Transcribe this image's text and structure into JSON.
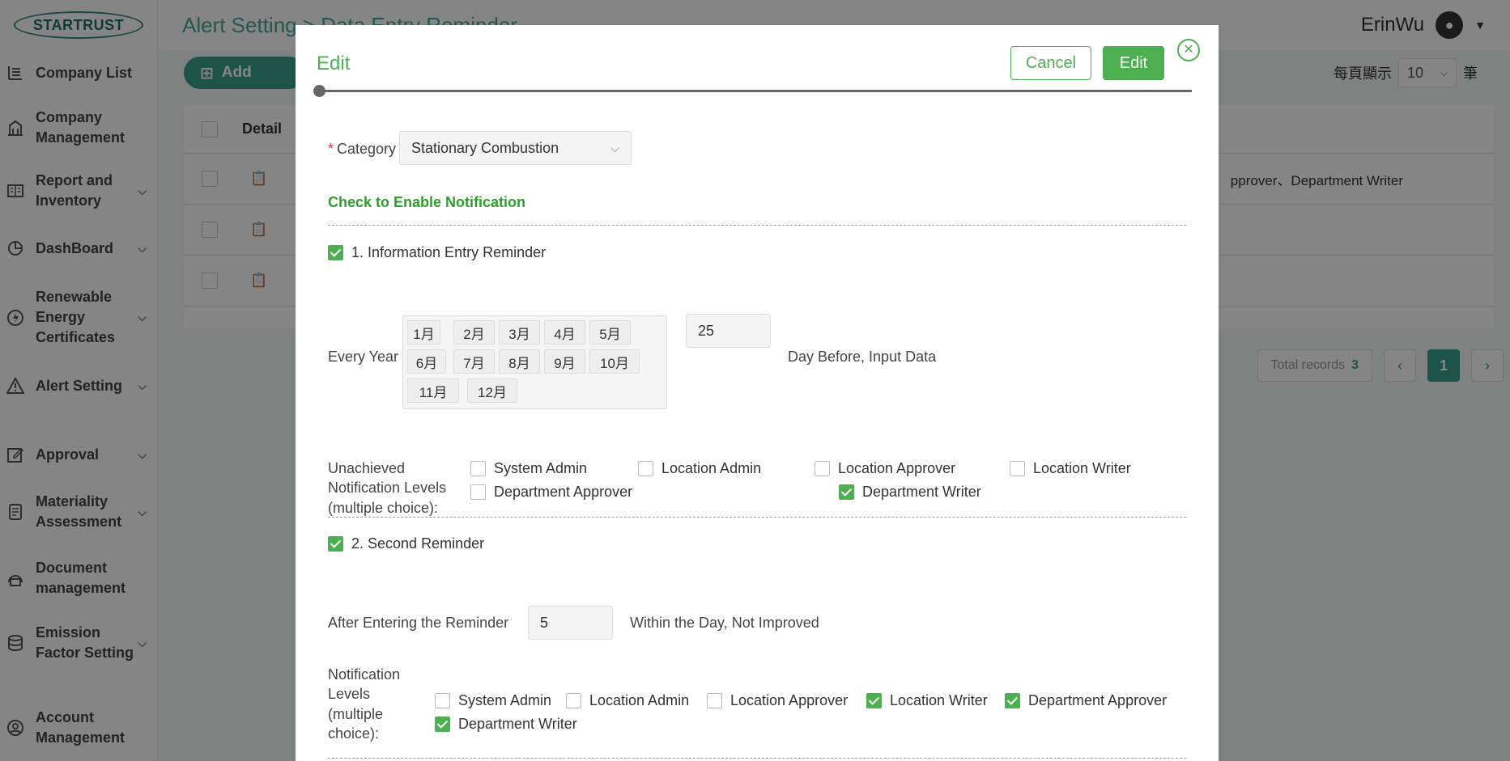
{
  "app": {
    "logo": "STARTRUST",
    "breadcrumb": "Alert Setting > Data Entry Reminder",
    "user": "ErinWu"
  },
  "sidebar": {
    "items": [
      {
        "label": "Company List",
        "icon": "list-icon"
      },
      {
        "label": "Company Management",
        "icon": "building-icon"
      },
      {
        "label": "Report and Inventory",
        "icon": "report-icon"
      },
      {
        "label": "DashBoard",
        "icon": "pie-chart-icon"
      },
      {
        "label": "Renewable Energy Certificates",
        "icon": "energy-icon"
      },
      {
        "label": "Alert Setting",
        "icon": "warning-icon"
      },
      {
        "label": "Approval",
        "icon": "edit-icon"
      },
      {
        "label": "Materiality Assessment",
        "icon": "book-icon"
      },
      {
        "label": "Document management",
        "icon": "document-icon"
      },
      {
        "label": "Emission Factor Setting",
        "icon": "database-icon"
      },
      {
        "label": "Account Management",
        "icon": "account-icon"
      }
    ]
  },
  "toolbar": {
    "add_label": "Add",
    "per_page_label": "每頁顯示",
    "per_page_value": "10",
    "per_page_unit": "筆"
  },
  "table": {
    "header_detail": "Detail",
    "row1_text": "pprover、Department Writer"
  },
  "pagination": {
    "total_label": "Total records",
    "total_value": "3",
    "current_page": "1"
  },
  "modal": {
    "title": "Edit",
    "cancel_label": "Cancel",
    "edit_label": "Edit",
    "category_label": "Category",
    "category_value": "Stationary Combustion",
    "section_title": "Check to Enable Notification",
    "reminder1_label": "1. Information Entry Reminder",
    "every_year_label": "Every Year",
    "months": [
      "1月",
      "2月",
      "3月",
      "4月",
      "5月",
      "6月",
      "7月",
      "8月",
      "9月",
      "10月",
      "11月",
      "12月"
    ],
    "day_value": "25",
    "day_suffix": "Day Before, Input Data",
    "unachieved_label_1": "Unachieved",
    "unachieved_label_2": "Notification Levels",
    "unachieved_label_3": "(multiple choice):",
    "levels1": {
      "system_admin": "System Admin",
      "location_admin": "Location Admin",
      "location_approver": "Location Approver",
      "location_writer": "Location Writer",
      "department_approver": "Department Approver",
      "department_writer": "Department Writer"
    },
    "reminder2_label": "2. Second Reminder",
    "after_label": "After Entering the Reminder",
    "after_value": "5",
    "after_suffix": "Within the Day, Not Improved",
    "notif_label_1": "Notification",
    "notif_label_2": "Levels",
    "notif_label_3": "(multiple",
    "notif_label_4": "choice):",
    "levels2": {
      "system_admin": "System Admin",
      "location_admin": "Location Admin",
      "location_approver": "Location Approver",
      "location_writer": "Location Writer",
      "department_approver": "Department Approver",
      "department_writer": "Department Writer"
    }
  },
  "colors": {
    "accent": "#4caf50",
    "brand": "#3aa08f"
  }
}
